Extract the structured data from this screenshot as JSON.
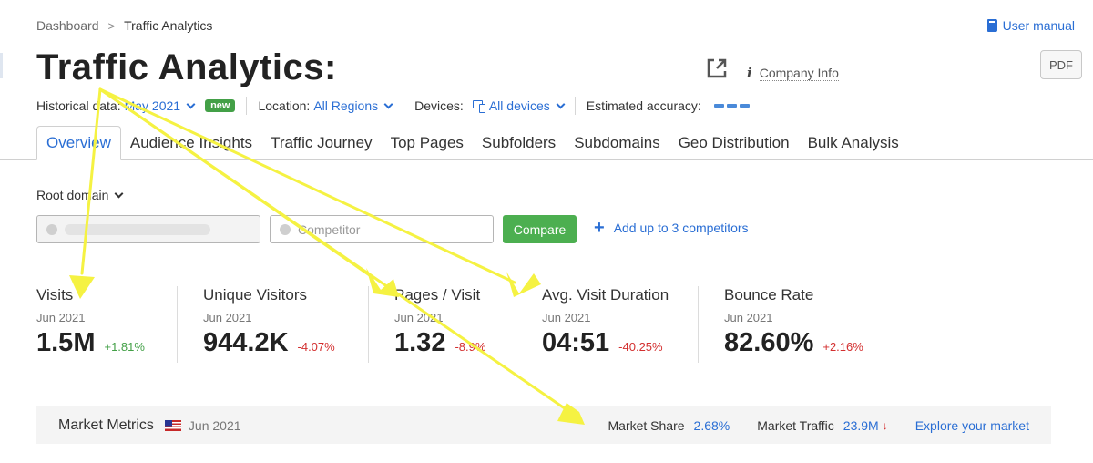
{
  "breadcrumb": {
    "root": "Dashboard",
    "separator": ">",
    "current": "Traffic Analytics"
  },
  "header": {
    "user_manual": "User manual",
    "title": "Traffic Analytics:",
    "company_info": "Company Info",
    "pdf": "PDF"
  },
  "filters": {
    "historical_label": "Historical data:",
    "historical_value": "May 2021",
    "new_badge": "new",
    "location_label": "Location:",
    "location_value": "All Regions",
    "devices_label": "Devices:",
    "devices_value": "All devices",
    "accuracy_label": "Estimated accuracy:"
  },
  "tabs": [
    {
      "label": "Overview",
      "active": true
    },
    {
      "label": "Audience Insights"
    },
    {
      "label": "Traffic Journey"
    },
    {
      "label": "Top Pages"
    },
    {
      "label": "Subfolders"
    },
    {
      "label": "Subdomains"
    },
    {
      "label": "Geo Distribution"
    },
    {
      "label": "Bulk Analysis"
    }
  ],
  "domain_select": "Root domain",
  "competitor": {
    "placeholder": "Competitor",
    "compare": "Compare",
    "add": "Add up to 3 competitors"
  },
  "metrics": [
    {
      "label": "Visits",
      "date": "Jun 2021",
      "value": "1.5M",
      "change": "+1.81%",
      "trend": "up"
    },
    {
      "label": "Unique Visitors",
      "date": "Jun 2021",
      "value": "944.2K",
      "change": "-4.07%",
      "trend": "down"
    },
    {
      "label": "Pages / Visit",
      "date": "Jun 2021",
      "value": "1.32",
      "change": "-8.9%",
      "trend": "down"
    },
    {
      "label": "Avg. Visit Duration",
      "date": "Jun 2021",
      "value": "04:51",
      "change": "-40.25%",
      "trend": "down"
    },
    {
      "label": "Bounce Rate",
      "date": "Jun 2021",
      "value": "82.60%",
      "change": "+2.16%",
      "trend": "up"
    }
  ],
  "market": {
    "title": "Market Metrics",
    "date": "Jun 2021",
    "share_label": "Market Share",
    "share_value": "2.68%",
    "traffic_label": "Market Traffic",
    "traffic_value": "23.9M",
    "explore": "Explore your market"
  },
  "colors": {
    "accent": "#2a6ed4",
    "positive": "#43a047",
    "negative": "#d32f2f",
    "annotation": "#f5f242"
  }
}
